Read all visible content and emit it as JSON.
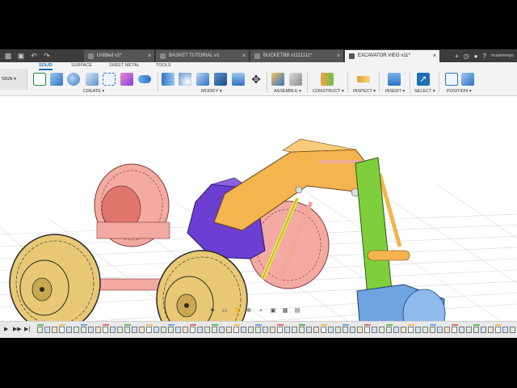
{
  "tabs": [
    {
      "label": "Untitled v2*",
      "active": false
    },
    {
      "label": "BASKET TUTORIAL v1",
      "active": false
    },
    {
      "label": "BUCKETBB v1111111*",
      "active": false
    },
    {
      "label": "EXCAVATOR VIEO v11*",
      "active": true
    }
  ],
  "tab_close": "×",
  "new_tab": "+",
  "user": "muammerpo",
  "workspace_button": "SIGN",
  "subtabs": [
    "SOLID",
    "SURFACE",
    "SHEET METAL",
    "TOOLS"
  ],
  "groups": [
    "CREATE",
    "MODIFY",
    "ASSEMBLE",
    "CONSTRUCT",
    "INSPECT",
    "INSERT",
    "SELECT",
    "POSITION"
  ],
  "colors": {
    "accent": "#1f6fb5",
    "tire": "#e8c874",
    "tire_dark": "#8a6a1e",
    "pink": "#f2aaa2",
    "boom_orange": "#f4b44e",
    "green_arm": "#7fcf3d",
    "bucket_blue": "#6fa4e0",
    "body_purple": "#6b3fd1"
  },
  "icons": {
    "menu": "grid-icon",
    "save": "save-icon",
    "undo": "undo-icon",
    "redo": "redo-icon",
    "play": "play-icon",
    "settings": "gear-icon",
    "help": "help-icon",
    "notifications": "clock-icon"
  }
}
